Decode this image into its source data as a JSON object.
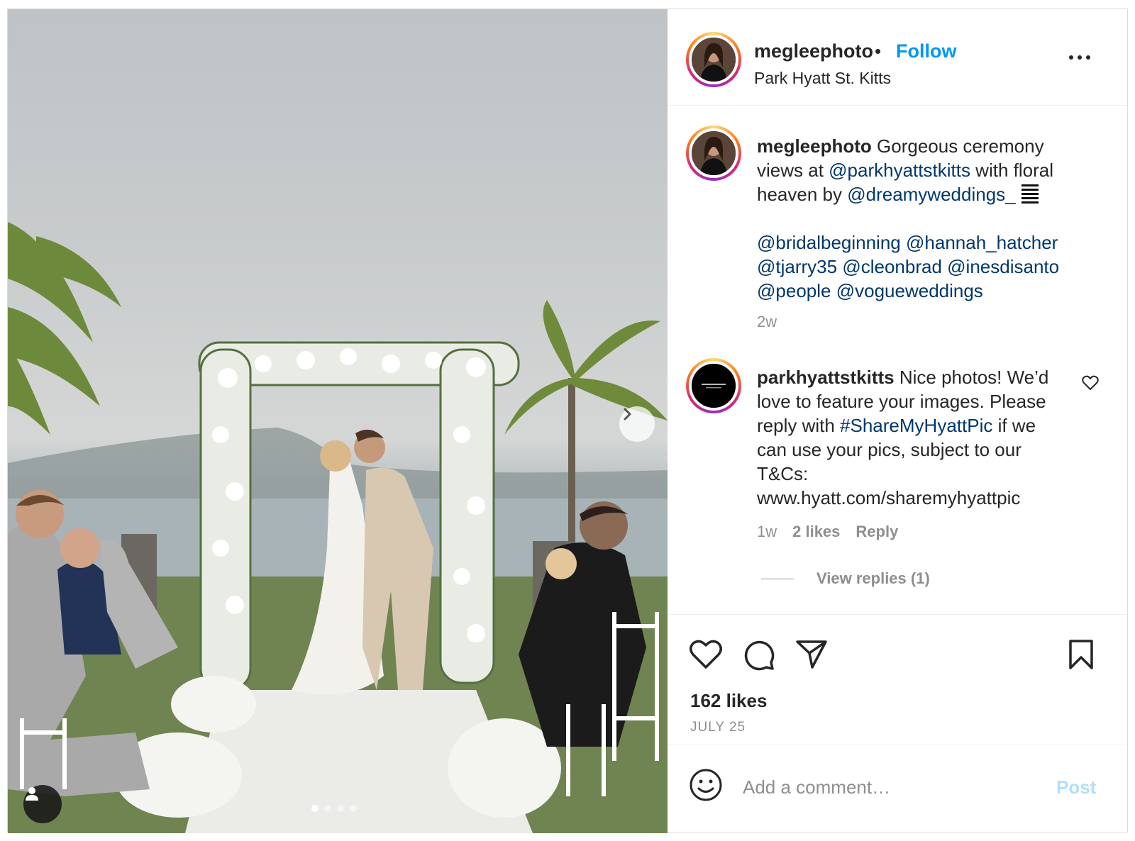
{
  "post": {
    "username": "megleephoto",
    "follow_label": "Follow",
    "separator": "•",
    "location": "Park Hyatt St. Kitts",
    "carousel": {
      "slide_count": 4,
      "active_index": 0
    }
  },
  "caption": {
    "username": "megleephoto",
    "line1": "Gorgeous ceremony",
    "line2_prefix": "views at ",
    "mention1": "@parkhyattstkitts",
    "line2_suffix": " with floral",
    "line3_prefix": "heaven by ",
    "mention2": "@dreamyweddings_",
    "tags_line1": [
      "@bridalbeginning",
      "@hannah_hatcher"
    ],
    "tags_line2": [
      "@tjarry35",
      "@cleonbrad",
      "@inesdisanto"
    ],
    "tags_line3": [
      "@people",
      "@vogueweddings"
    ],
    "time": "2w"
  },
  "comment": {
    "username": "parkhyattstkitts",
    "line1": "Nice photos! We’d",
    "line2": "love to feature your images. Please",
    "line3_prefix": "reply with ",
    "hashtag": "#ShareMyHyattPic",
    "line3_suffix": " if we",
    "line4": "can use your pics, subject to our",
    "line5": "T&Cs:",
    "line6": "www.hyatt.com/sharemyhyattpic",
    "time": "1w",
    "likes": "2 likes",
    "reply_label": "Reply",
    "view_replies": "View replies (1)"
  },
  "actions": {
    "likes": "162 likes",
    "date": "JULY 25"
  },
  "add_comment": {
    "placeholder": "Add a comment…",
    "post_label": "Post"
  },
  "icons": [
    "heart-icon",
    "comment-icon",
    "share-icon",
    "bookmark-icon",
    "emoji-icon",
    "chevron-right-icon",
    "user-tag-icon",
    "more-icon"
  ],
  "colors": {
    "link": "#00376b",
    "follow": "#0095f6",
    "muted": "#8e8e8e",
    "post_disabled": "#b2dffc"
  }
}
